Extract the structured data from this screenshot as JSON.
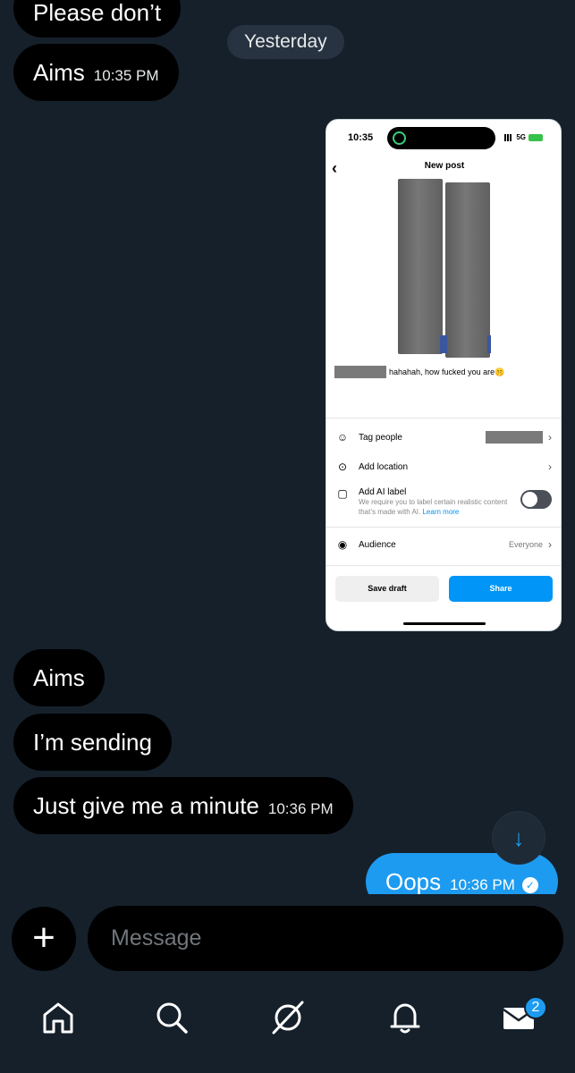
{
  "day_separator": "Yesterday",
  "messages": {
    "m0": {
      "text": "Please don’t"
    },
    "m1": {
      "text": "Aims",
      "time": "10:35 PM"
    },
    "m2": {
      "text": "Aims"
    },
    "m3": {
      "text": "I’m sending"
    },
    "m4": {
      "text": "Just give me a minute",
      "time": "10:36 PM"
    },
    "m5": {
      "text": "Oops",
      "time": "10:36 PM"
    }
  },
  "screenshot": {
    "status_time": "10:35",
    "network": "5G",
    "title": "New post",
    "caption": "hahahah, how fucked you are🤫",
    "rows": {
      "tag_people": "Tag people",
      "add_location": "Add location",
      "ai_label": "Add AI label",
      "ai_label_sub": "We require you to label certain realistic content that’s made with AI.",
      "learn_more": "Learn more",
      "audience": "Audience",
      "audience_value": "Everyone"
    },
    "save_draft": "Save draft",
    "share": "Share"
  },
  "composer": {
    "placeholder": "Message"
  },
  "tabs": {
    "dm_badge": "2"
  },
  "colors": {
    "background": "#15202b",
    "bubble_received": "#000000",
    "bubble_sent": "#1d9bf0"
  },
  "icons": [
    "plus-icon",
    "home-icon",
    "search-icon",
    "grok-icon",
    "bell-icon",
    "mail-icon",
    "arrow-down-icon",
    "check-icon"
  ]
}
